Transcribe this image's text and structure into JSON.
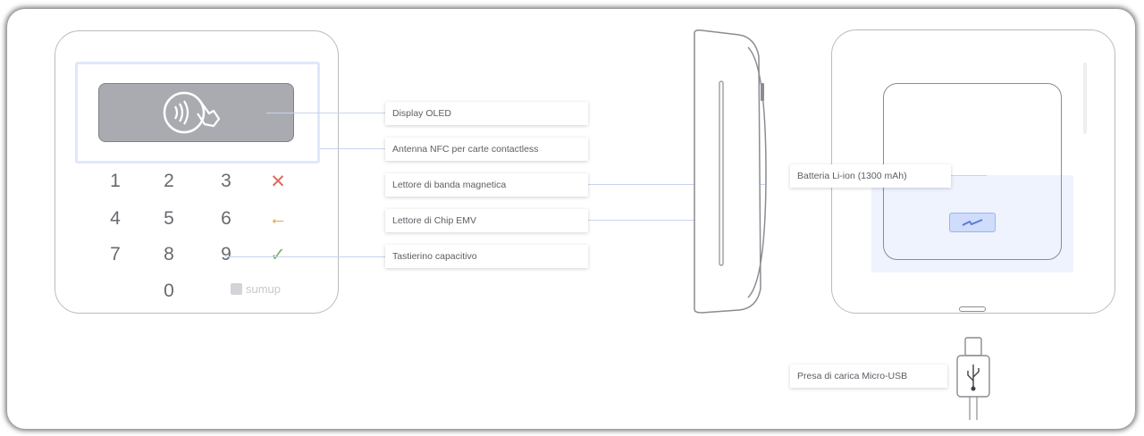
{
  "labels": {
    "oled": "Display OLED",
    "nfc": "Antenna NFC per carte contactless",
    "magstripe": "Lettore di banda magnetica",
    "chip": "Lettore di Chip EMV",
    "keypad": "Tastierino capacitivo",
    "battery": "Batteria Li-ion (1300 mAh)",
    "usb": "Presa di carica Micro-USB"
  },
  "keypad": {
    "keys": [
      "1",
      "2",
      "3",
      "4",
      "5",
      "6",
      "7",
      "8",
      "9",
      "0"
    ],
    "cancel": "✕",
    "back": "←",
    "ok": "✓"
  },
  "brand": "sumup",
  "icons": [
    "contactless-icon",
    "lightning-bolt-icon",
    "usb-icon"
  ],
  "colors": {
    "accent_line": "#c7d3ee",
    "cancel": "#e06b62",
    "back": "#d8a43b",
    "ok": "#78b86b",
    "highlight": "#dde8fb"
  }
}
